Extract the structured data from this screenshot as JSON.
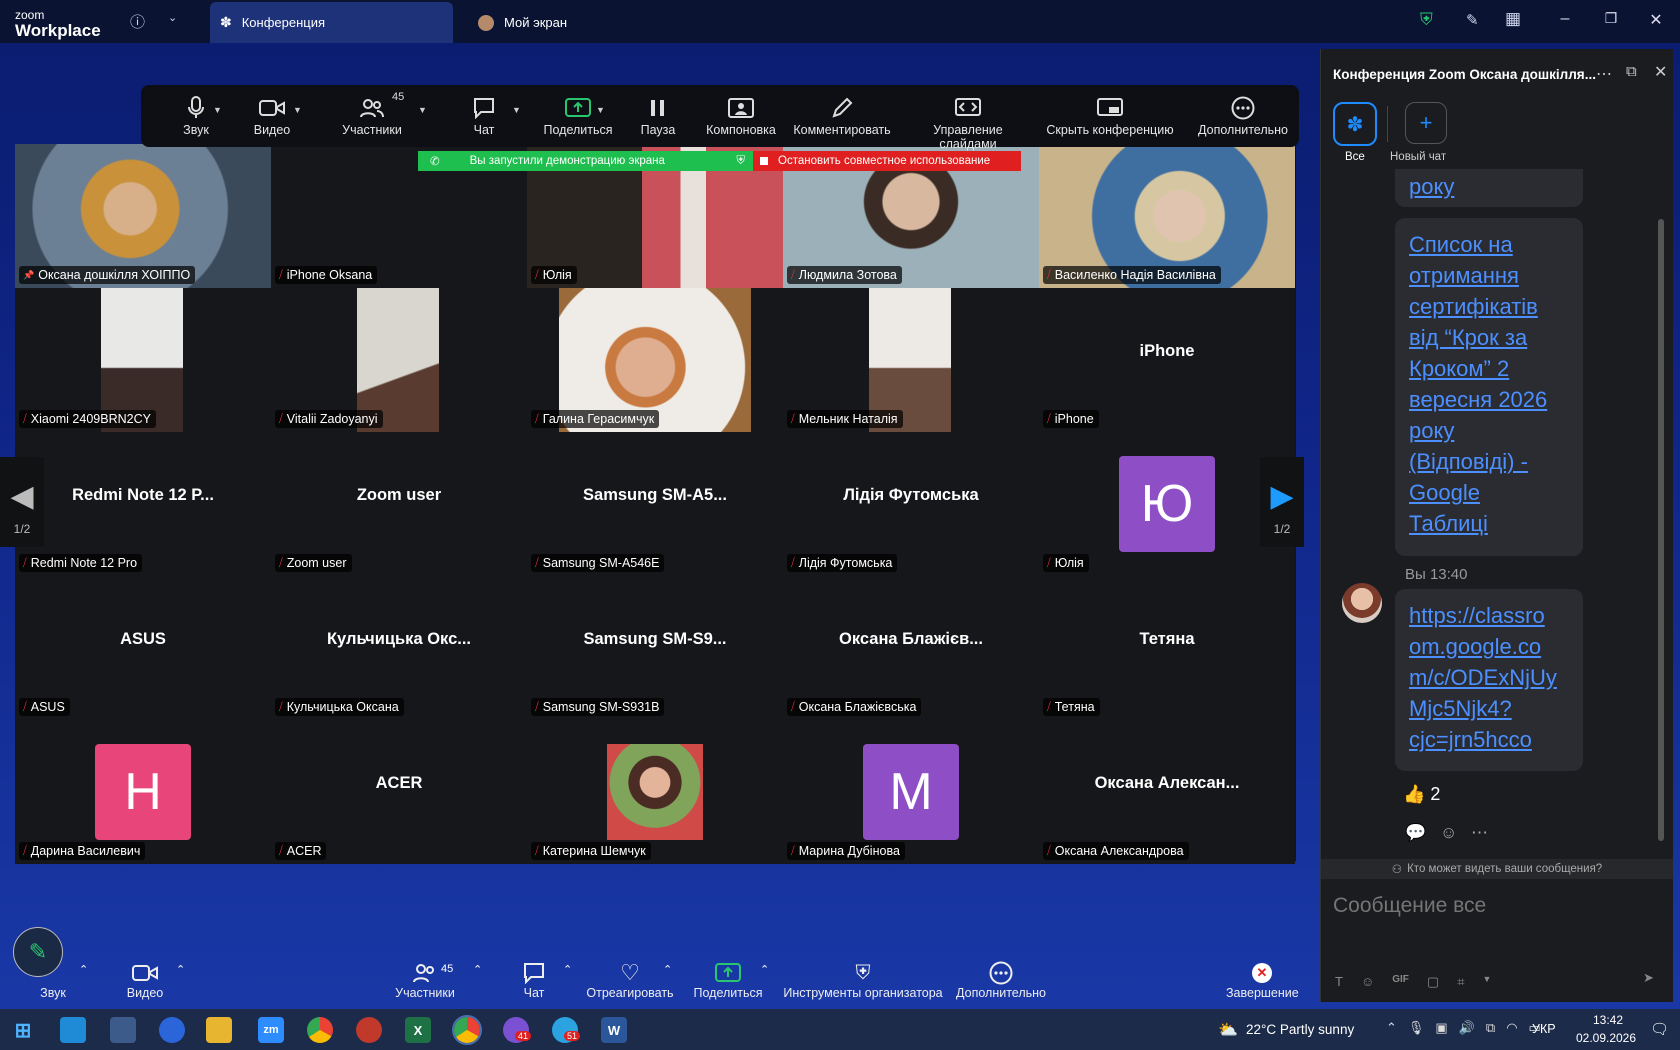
{
  "app": {
    "brand_small": "zoom",
    "brand_big": "Workplace"
  },
  "tabs": [
    {
      "label": "Конференция"
    },
    {
      "label": "Мой экран"
    }
  ],
  "toolbar": {
    "audio": "Звук",
    "video": "Видео",
    "participants": "Участники",
    "participants_count": "45",
    "chat": "Чат",
    "share": "Поделиться",
    "pause": "Пауза",
    "layout": "Компоновка",
    "annotate": "Комментировать",
    "slides": "Управление слайдами",
    "hide": "Скрыть конференцию",
    "more": "Дополнительно"
  },
  "share_banner": {
    "started": "Вы запустили демонстрацию экрана",
    "stop": "Остановить совместное использование"
  },
  "tiles": [
    {
      "name": "Оксана дошкілля ХОІППО",
      "big": ""
    },
    {
      "name": "iPhone Oksana",
      "big": ""
    },
    {
      "name": "Юлія",
      "big": ""
    },
    {
      "name": "Людмила Зотова",
      "big": ""
    },
    {
      "name": "Василенко Надія Василівна",
      "big": ""
    },
    {
      "name": "Xiaomi 2409BRN2CY",
      "big": ""
    },
    {
      "name": "Vitalii Zadoyanyi",
      "big": ""
    },
    {
      "name": "Галина Герасимчук",
      "big": ""
    },
    {
      "name": "Мельник Наталія",
      "big": ""
    },
    {
      "name": "iPhone",
      "big": "iPhone"
    },
    {
      "name": "Redmi Note 12 Pro",
      "big": "Redmi Note 12 P..."
    },
    {
      "name": "Zoom user",
      "big": "Zoom user"
    },
    {
      "name": "Samsung SM-A546E",
      "big": "Samsung  SM-A5..."
    },
    {
      "name": "Лідія Футомська",
      "big": "Лідія Футомська"
    },
    {
      "name": "Юлія",
      "big": "",
      "avatar": "Ю"
    },
    {
      "name": "ASUS",
      "big": "ASUS"
    },
    {
      "name": "Кульчицька Оксана",
      "big": "Кульчицька  Окс..."
    },
    {
      "name": "Samsung SM-S931B",
      "big": "Samsung  SM-S9..."
    },
    {
      "name": "Оксана Блажієвська",
      "big": "Оксана  Блажієв..."
    },
    {
      "name": "Тетяна",
      "big": "Тетяна"
    },
    {
      "name": "Дарина Василевич",
      "big": "",
      "avatar": "Н"
    },
    {
      "name": "ACER",
      "big": "ACER"
    },
    {
      "name": "Катерина Шемчук",
      "big": ""
    },
    {
      "name": "Марина Дубінова",
      "big": "",
      "avatar": "M"
    },
    {
      "name": "Оксана Александрова",
      "big": "Оксана  Алексан..."
    }
  ],
  "pager": {
    "left": "1/2",
    "right": "1/2"
  },
  "chat": {
    "title": "Конференция Zoom Оксана дошкілля...",
    "tab_all": "Все",
    "tab_new": "Новый чат",
    "prev_tail": "року",
    "msg1": [
      "Список на",
      "отримання",
      "сертифікатів",
      "від “Крок за",
      "Кроком” 2",
      "вересня 2026",
      "року",
      "(Відповіді) -",
      "Google",
      "Таблиці"
    ],
    "sender": "Вы 13:40",
    "msg2": [
      "https://classro",
      "om.google.co",
      "m/c/ODExNjUy",
      "Mjc5Njk4?",
      "cjc=jrn5hcco"
    ],
    "reaction": "👍 2",
    "visibility": "Кто может видеть ваши сообщения?",
    "placeholder": "Сообщение все"
  },
  "bottom": {
    "audio": "Звук",
    "video": "Видео",
    "participants": "Участники",
    "participants_count": "45",
    "chat": "Чат",
    "react": "Отреагировать",
    "share": "Поделиться",
    "host": "Инструменты организатора",
    "more": "Дополнительно",
    "end": "Завершение"
  },
  "taskbar": {
    "weather": "22°C  Partly sunny",
    "lang": "УКР",
    "time": "13:42",
    "date": "02.09.2026",
    "viber_badge": "41",
    "telegram_badge": "51"
  },
  "colors": {
    "accent": "#0e72ed",
    "share_green": "#1fbf4f",
    "stop_red": "#e02020",
    "mic_off": "#e5353b",
    "link": "#4c8fff"
  }
}
